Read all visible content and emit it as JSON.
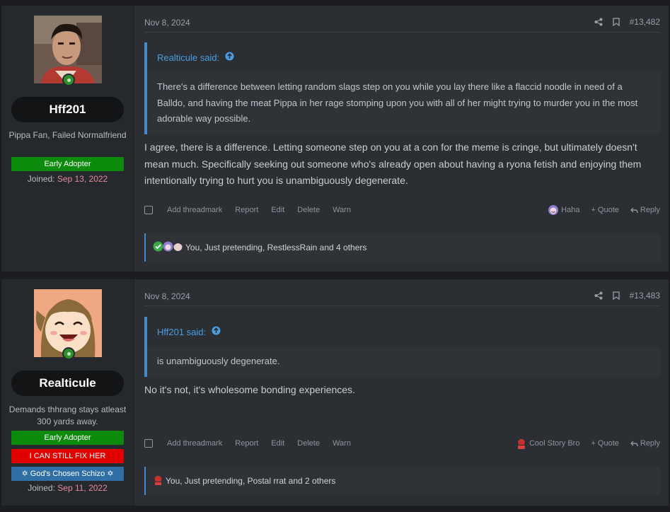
{
  "posts": [
    {
      "user": {
        "name": "Hff201",
        "title": "Pippa Fan, Failed Normalfriend",
        "banners": [
          {
            "text": "Early Adopter",
            "color": "#0c8a0c"
          }
        ],
        "joined_label": "Joined:",
        "joined_date": "Sep 13, 2022"
      },
      "date": "Nov 8, 2024",
      "post_number": "#13,482",
      "quote": {
        "author": "Realticule said:",
        "text": "There's a difference between letting random slags step on you while you lay there like a flaccid noodle in need of a Balldo, and having the meat Pippa in her rage stomping upon you with all of her might trying to murder you in the most adorable way possible."
      },
      "message": "I agree, there is a difference. Letting someone step on you at a con for the meme is cringe, but ultimately doesn't mean much. Specifically seeking out someone who's already open about having a ryona fetish and enjoying them intentionally trying to hurt you is unambiguously degenerate.",
      "actions": [
        "Add threadmark",
        "Report",
        "Edit",
        "Delete",
        "Warn"
      ],
      "reaction_button": "Haha",
      "quote_label": "Quote",
      "reply_label": "Reply",
      "reactions_summary": "You, Just pretending, RestlessRain and 4 others"
    },
    {
      "user": {
        "name": "Realticule",
        "title": "Demands thhrang stays atleast 300 yards away.",
        "banners": [
          {
            "text": "Early Adopter",
            "color": "#0c8a0c"
          },
          {
            "text": "I CAN STILL FIX HER",
            "color": "#e00000"
          },
          {
            "text": "✡ God's Chosen Schizo ✡",
            "color": "#2f6fa6"
          }
        ],
        "joined_label": "Joined:",
        "joined_date": "Sep 11, 2022"
      },
      "date": "Nov 8, 2024",
      "post_number": "#13,483",
      "quote": {
        "author": "Hff201 said:",
        "text": "is unambiguously degenerate."
      },
      "message": "No it's not, it's wholesome bonding experiences.",
      "actions": [
        "Add threadmark",
        "Report",
        "Edit",
        "Delete",
        "Warn"
      ],
      "reaction_button": "Cool Story Bro",
      "quote_label": "Quote",
      "reply_label": "Reply",
      "reactions_summary": "You, Just pretending, Postal rrat and 2 others"
    }
  ],
  "colors": {
    "accent": "#3f8ad0",
    "joined_date": "#e58a9a",
    "post_bg": "#2b2e32"
  }
}
